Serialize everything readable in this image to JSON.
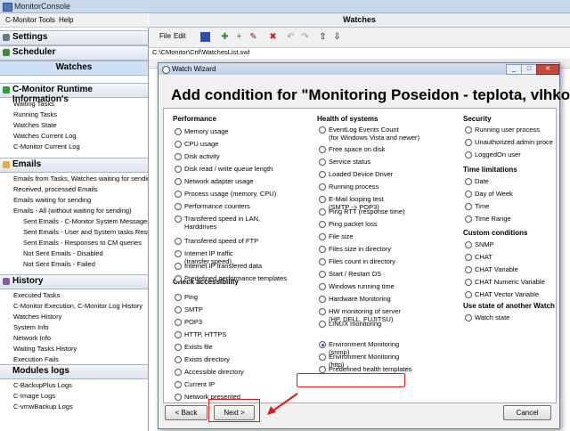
{
  "app": {
    "title": "MonitorConsole"
  },
  "menu": {
    "items": [
      "C-Monitor Tools",
      "Help"
    ]
  },
  "left": {
    "sections": [
      {
        "label": "Settings",
        "icon": "gear-icon"
      },
      {
        "label": "Scheduler",
        "icon": "clock-icon"
      },
      {
        "label": "Watches",
        "icon": ""
      },
      {
        "label": "C-Monitor Runtime Information's",
        "icon": "info-icon"
      },
      {
        "label": "Emails",
        "icon": "email-icon"
      },
      {
        "label": "History",
        "icon": "history-icon"
      },
      {
        "label": "Modules logs",
        "icon": ""
      }
    ],
    "runtime_items": [
      "Waiting Tasks",
      "Running Tasks",
      "Watches State",
      "Watches Current Log",
      "C-Monitor Current Log"
    ],
    "email_items": [
      "Emails from Tasks, Watches waiting for sending",
      "Received, processed Emails",
      "Emails waiting for sending",
      "Emails - All (without waiting for sending)"
    ],
    "email_sub_items": [
      "Sent Emails - C-Monitor System Messages",
      "Sent Emails - User and System tasks Results",
      "Sent Emails - Responses to CM queries",
      "Not Sent Emails - Disabled",
      "Not Sent Emails - Failed"
    ],
    "history_items": [
      "Executed Tasks",
      "C-Monitor Execution, C-Monitor Log History",
      "Watches History",
      "System Info",
      "Network Info",
      "Waiting Tasks History",
      "Execution Fails"
    ],
    "module_items": [
      "C-BackupPlus Logs",
      "C-Image Logs",
      "C-vmwBackup Logs"
    ]
  },
  "right": {
    "title": "Watches",
    "toolbar": {
      "file": "File",
      "edit": "Edit"
    },
    "path": "C:\\CMonitor\\Cnf\\WatchesList.swl"
  },
  "dialog": {
    "title": "Watch Wizard",
    "heading": "Add condition for \"Monitoring Poseidon - teplota, vlhko",
    "groups": {
      "performance": {
        "label": "Performance",
        "options": [
          "Memory usage",
          "CPU usage",
          "Disk activity",
          "Disk read / write queue length",
          "Network adapter usage",
          "Process usage (memory, CPU)",
          "Performance counters",
          "Transfered speed in LAN, Harddrives",
          "Transfered speed of FTP",
          "Internet IP traffic (transfer speed)",
          "Internet IP transfered data",
          "Predefined performance templates"
        ]
      },
      "accessibility": {
        "label": "Check accessibility",
        "options": [
          "Ping",
          "SMTP",
          "POP3",
          "HTTP, HTTPS",
          "Exists file",
          "Exists directory",
          "Accessible directory",
          "Current IP",
          "Network presented (active any network adapter)"
        ]
      },
      "health": {
        "label": "Health of systems",
        "options": [
          "EventLog Events Count (for Windows Vista and newer)",
          "Free space on disk",
          "Service status",
          "Loaded Device Driver",
          "Running process",
          "E-Mail looping test (SMTP -> POP3)",
          "Ping RTT (response time)",
          "Ping packet loss",
          "File size",
          "Files size in directory",
          "Files count in directory",
          "Start / Restart OS",
          "Windows running time",
          "Hardware Monitoring",
          "HW monitoring of server (HP, DELL, FUJITSU)",
          "LINUX monitoring",
          "Environment Monitoring (snmp)",
          "Environment Monitoring (http)",
          "Predefined health templates"
        ],
        "selected_index": 16
      },
      "security": {
        "label": "Security",
        "options": [
          "Running user process",
          "Unauthorized admin proce",
          "LoggedOn user"
        ]
      },
      "time": {
        "label": "Time limitations",
        "options": [
          "Date",
          "Day of Week",
          "Time",
          "Time Range"
        ]
      },
      "custom": {
        "label": "Custom conditions",
        "options": [
          "SNMP",
          "CHAT",
          "CHAT Variable",
          "CHAT Numeric Variable",
          "CHAT Vector Variable"
        ]
      },
      "state": {
        "label": "Use state of another Watch",
        "options": [
          "Watch state"
        ]
      }
    },
    "buttons": {
      "back": "< Back",
      "next": "Next >",
      "cancel": "Cancel"
    }
  },
  "colors": {
    "highlight": "#d62020",
    "selection": "#2255cc"
  }
}
